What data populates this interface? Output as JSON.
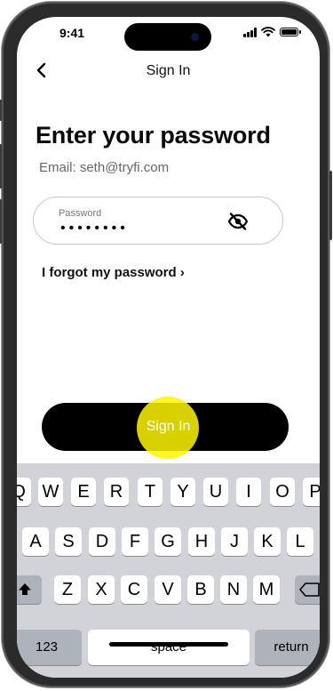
{
  "status_bar": {
    "time": "9:41"
  },
  "nav": {
    "title": "Sign In"
  },
  "content": {
    "heading": "Enter your password",
    "email_line": "Email: seth@tryfi.com",
    "password_label": "Password",
    "password_value": "••••••••",
    "forgot_link": "I forgot my password ›",
    "signin_label": "Sign In"
  },
  "keyboard": {
    "row1": [
      "Q",
      "W",
      "E",
      "R",
      "T",
      "Y",
      "U",
      "I",
      "O",
      "P"
    ],
    "row2": [
      "A",
      "S",
      "D",
      "F",
      "G",
      "H",
      "J",
      "K",
      "L"
    ],
    "row3": [
      "Z",
      "X",
      "C",
      "V",
      "B",
      "N",
      "M"
    ],
    "numbers_label": "123",
    "space_label": "space",
    "return_label": "return"
  },
  "icons": {
    "back": "chevron-left-icon",
    "password_visibility": "eye-slash-icon",
    "shift": "shift-icon",
    "delete": "backspace-icon"
  },
  "colors": {
    "button": "#000000",
    "tap_highlight": "#fff500",
    "keyboard_bg": "#d1d3d9"
  }
}
